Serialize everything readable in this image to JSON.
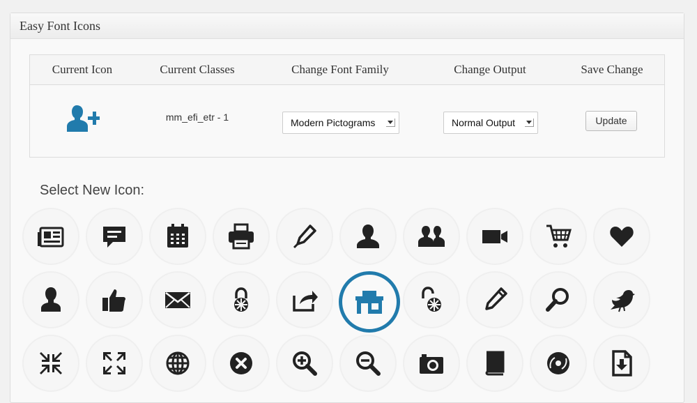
{
  "panel": {
    "title": "Easy Font Icons"
  },
  "table": {
    "headers": [
      "Current Icon",
      "Current Classes",
      "Change Font Family",
      "Change Output",
      "Save Change"
    ],
    "current_icon": "add-user-icon",
    "current_classes": "mm_efi_etr - 1",
    "font_family": "Modern Pictograms",
    "output": "Normal Output",
    "update_label": "Update"
  },
  "select_label": "Select New Icon:",
  "colors": {
    "accent": "#217bac",
    "icon": "#222222"
  },
  "icons": {
    "row1": [
      "newspaper-icon",
      "chat-icon",
      "calendar-icon",
      "printer-icon",
      "pen-icon",
      "user-icon",
      "users-icon",
      "video-camera-icon",
      "cart-icon",
      "heart-icon"
    ],
    "row2": [
      "user-alt-icon",
      "thumbs-up-icon",
      "envelope-icon",
      "lock-icon",
      "share-icon",
      "home-icon",
      "unlock-icon",
      "pencil-icon",
      "search-icon",
      "bird-icon"
    ],
    "row3": [
      "contract-icon",
      "expand-icon",
      "globe-icon",
      "close-icon",
      "zoom-in-icon",
      "zoom-out-icon",
      "camera-icon",
      "book-icon",
      "disc-icon",
      "download-icon"
    ],
    "selected_icon": "home-icon"
  }
}
